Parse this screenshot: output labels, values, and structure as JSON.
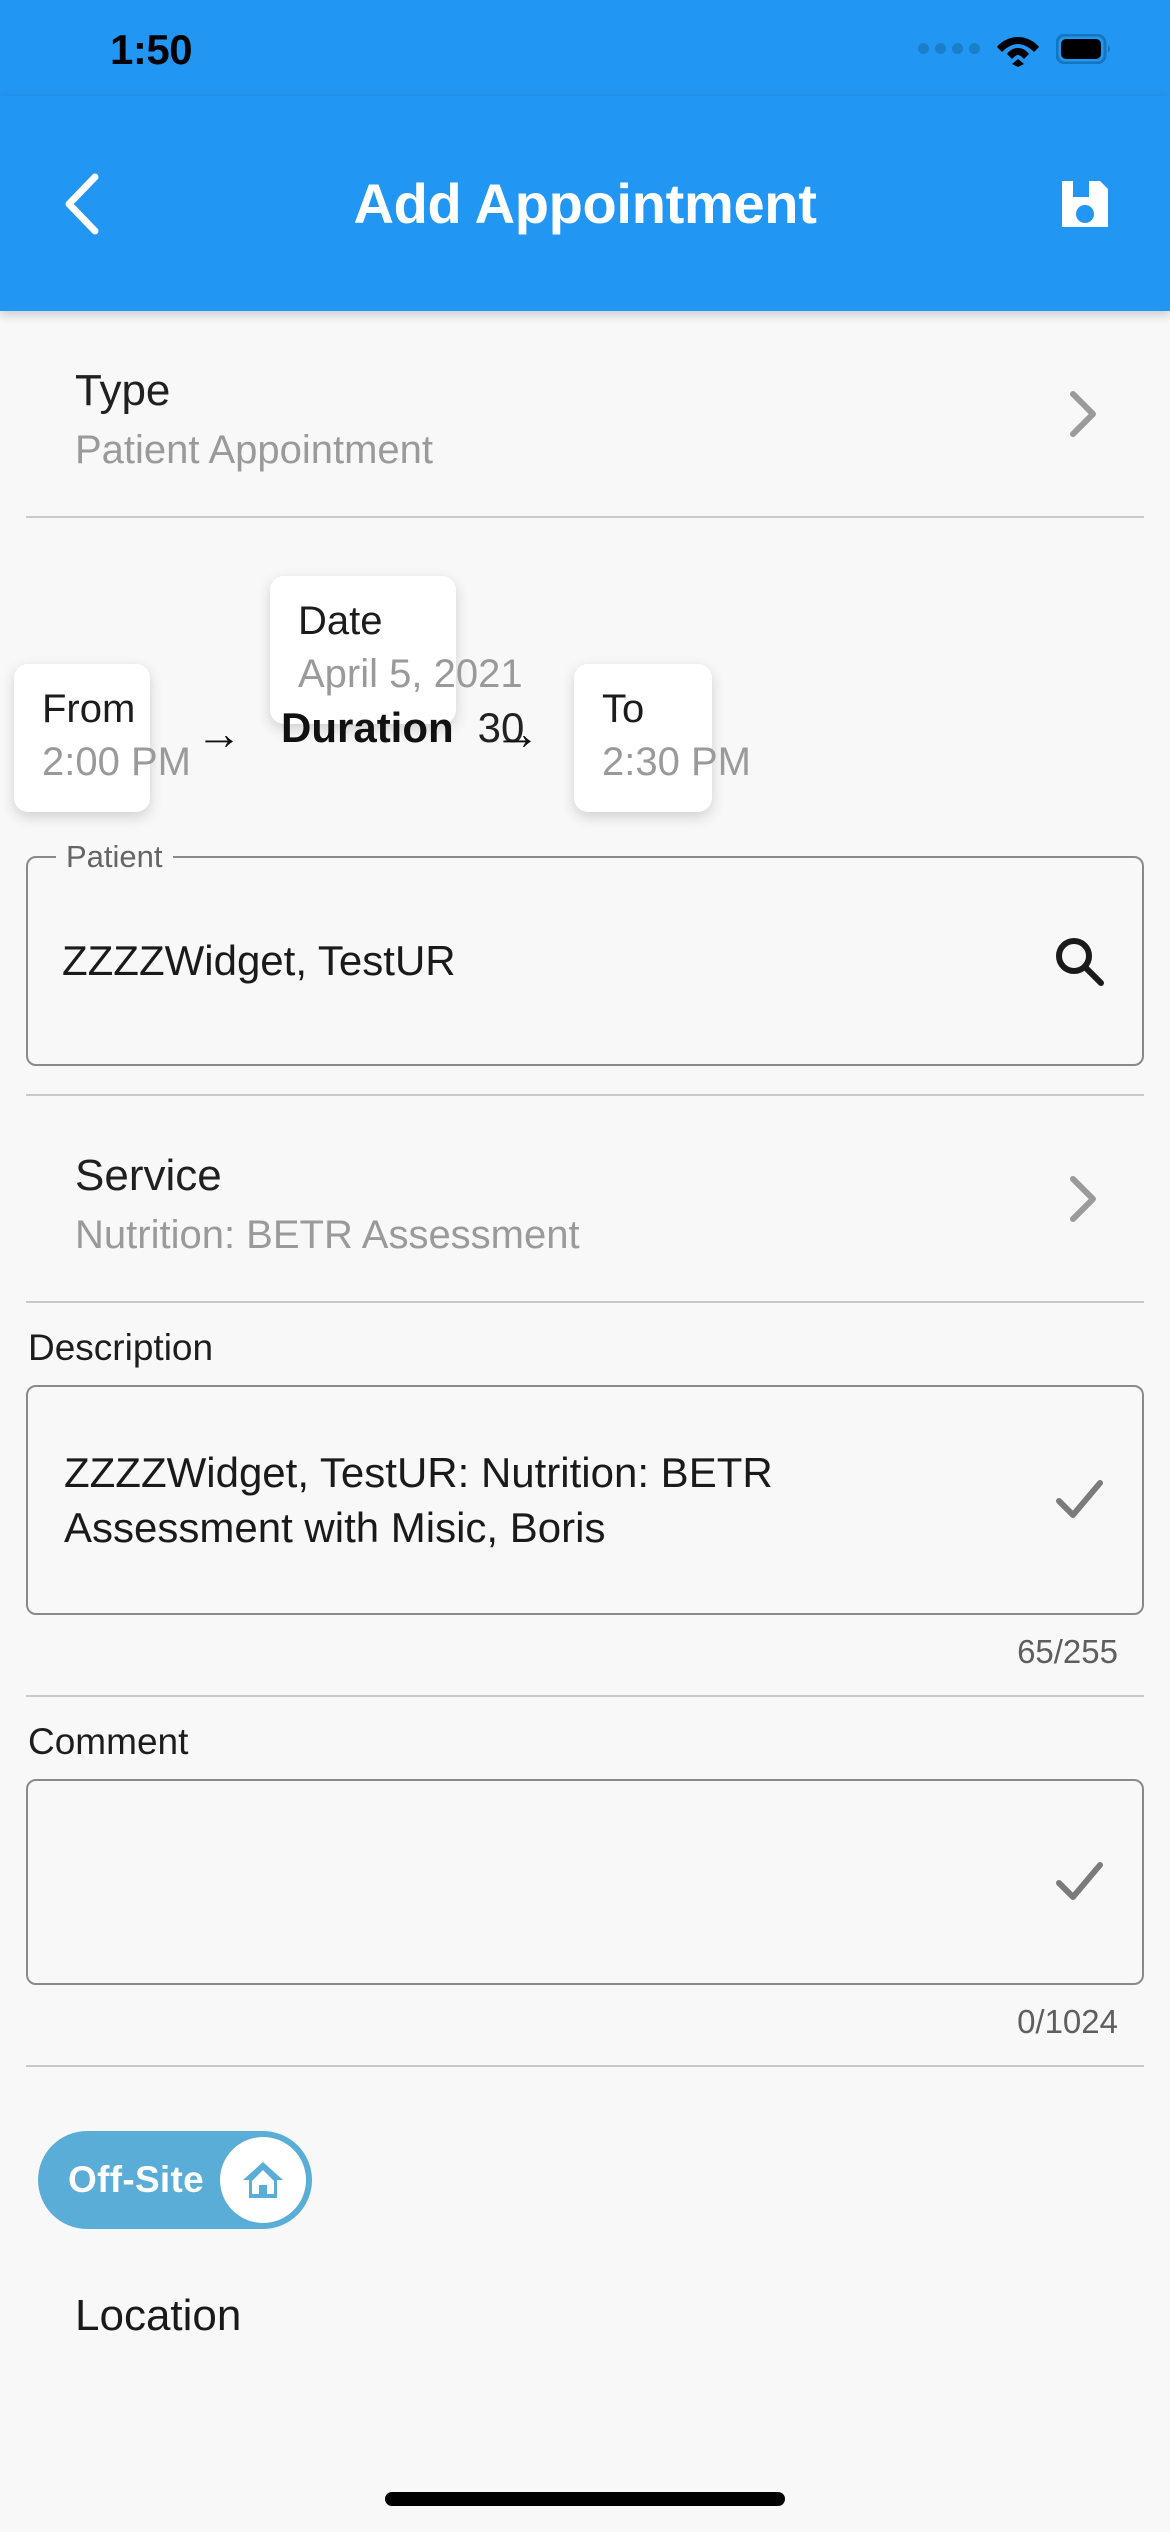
{
  "status_bar": {
    "time": "1:50",
    "cellular_icon": "cellular-dots-icon",
    "wifi_icon": "wifi-icon",
    "battery_icon": "battery-full-icon"
  },
  "app_bar": {
    "back_icon": "chevron-left-icon",
    "title": "Add Appointment",
    "save_icon": "save-disk-icon",
    "background_color": "#2196f3"
  },
  "type_row": {
    "title": "Type",
    "value": "Patient Appointment",
    "chevron_icon": "chevron-right-icon"
  },
  "schedule": {
    "date": {
      "label": "Date",
      "value": "April 5, 2021"
    },
    "from": {
      "label": "From",
      "value": "2:00 PM"
    },
    "to": {
      "label": "To",
      "value": "2:30 PM"
    },
    "duration": {
      "label": "Duration",
      "value": "30"
    },
    "arrow_glyph": "→"
  },
  "patient_field": {
    "label": "Patient",
    "value": "ZZZZWidget, TestUR",
    "placeholder": "",
    "search_icon": "search-icon"
  },
  "service_row": {
    "title": "Service",
    "value": "Nutrition: BETR Assessment",
    "chevron_icon": "chevron-right-icon"
  },
  "description": {
    "label": "Description",
    "value": "ZZZZWidget, TestUR: Nutrition: BETR\nAssessment with Misic, Boris",
    "placeholder": "",
    "counter": "65/255",
    "confirm_icon": "check-icon"
  },
  "comment": {
    "label": "Comment",
    "value": "",
    "placeholder": "",
    "counter": "0/1024",
    "confirm_icon": "check-icon"
  },
  "offsite": {
    "label": "Off-Site",
    "knob_icon": "home-icon",
    "active_color": "#5aadd6"
  },
  "location": {
    "label": "Location"
  },
  "home_indicator": {
    "name": "home-indicator"
  }
}
